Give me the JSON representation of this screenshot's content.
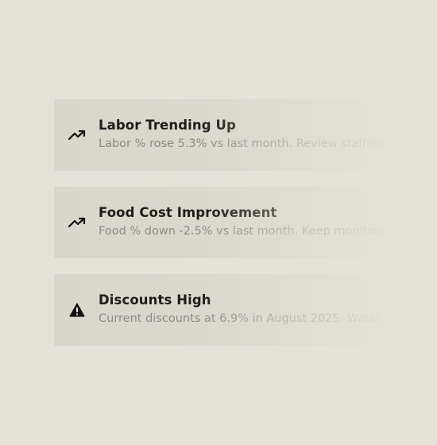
{
  "alerts": [
    {
      "icon": "trending-up-icon",
      "title": "Labor Trending Up",
      "description": "Labor % rose 5.3% vs last month. Review staffing."
    },
    {
      "icon": "trending-up-icon",
      "title": "Food Cost Improvement",
      "description": "Food % down -2.5% vs last month. Keep monitoring."
    },
    {
      "icon": "warning-icon",
      "title": "Discounts High",
      "description": "Current discounts at 6.9% in August 2025. Watch promos."
    }
  ],
  "colors": {
    "background": "#e4e3d7",
    "card": "#d9d7ca",
    "title": "#1c1c1a",
    "description": "#8c8b83",
    "icon": "#111111"
  }
}
